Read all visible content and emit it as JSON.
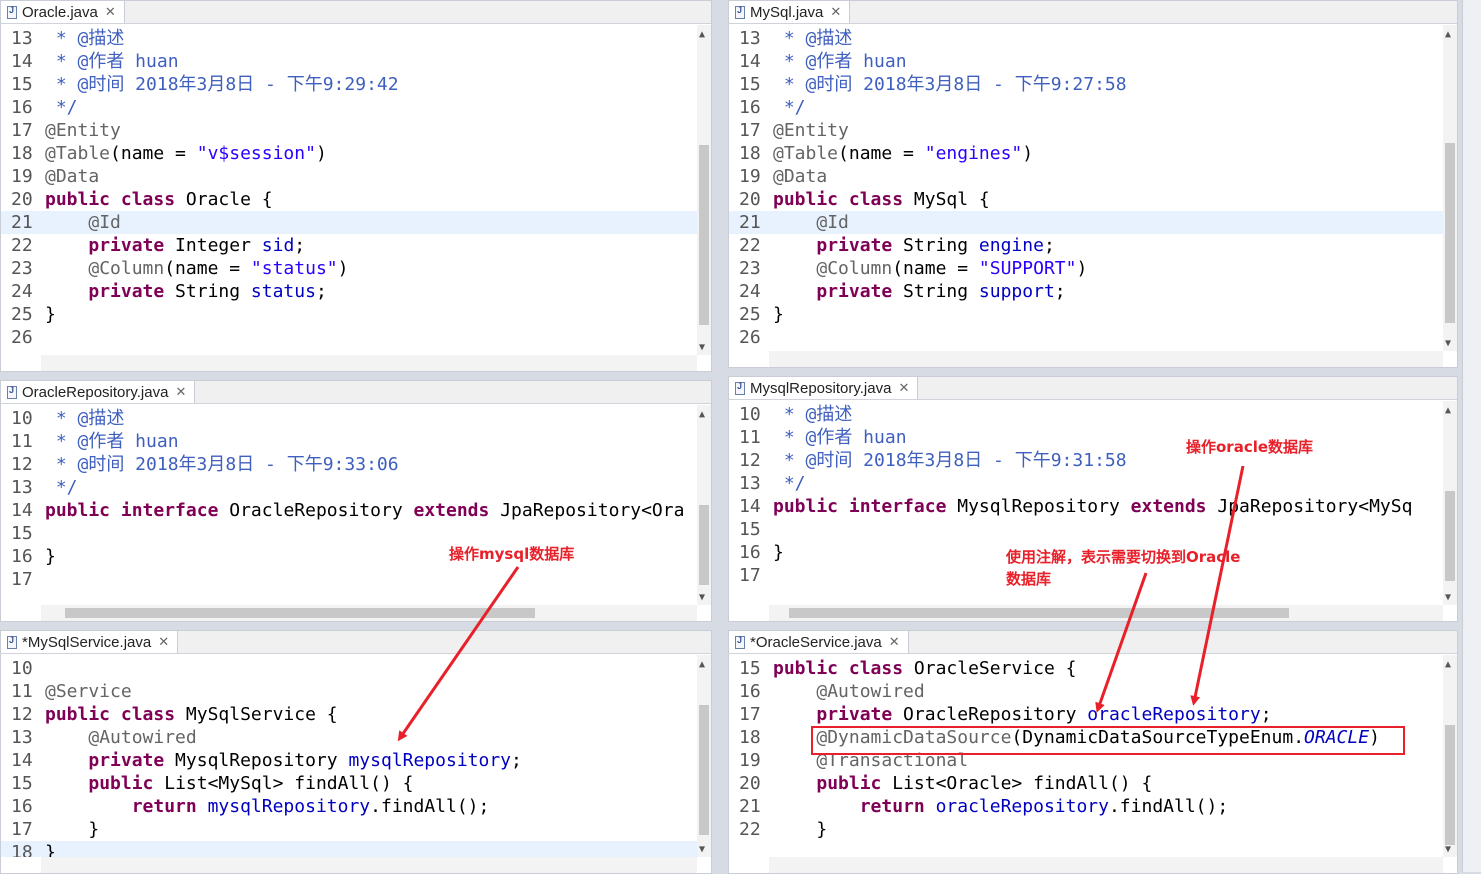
{
  "panes": {
    "oracle": {
      "tab": "Oracle.java",
      "lines": [
        {
          "n": "13",
          "t": " * @描述"
        },
        {
          "n": "14",
          "t": " * @作者 huan"
        },
        {
          "n": "15",
          "t": " * @时间 2018年3月8日 - 下午9:29:42"
        },
        {
          "n": "16",
          "t": " */"
        },
        {
          "n": "17",
          "t": "@Entity"
        },
        {
          "n": "18",
          "t": "@Table(name = \"v$session\")"
        },
        {
          "n": "19",
          "t": "@Data"
        },
        {
          "n": "20",
          "t": "public class Oracle {"
        },
        {
          "n": "21",
          "t": "    @Id"
        },
        {
          "n": "22",
          "t": "    private Integer sid;"
        },
        {
          "n": "23",
          "t": "    @Column(name = \"status\")"
        },
        {
          "n": "24",
          "t": "    private String status;"
        },
        {
          "n": "25",
          "t": "}"
        },
        {
          "n": "26",
          "t": ""
        }
      ]
    },
    "mysql": {
      "tab": "MySql.java",
      "lines": [
        {
          "n": "13",
          "t": " * @描述"
        },
        {
          "n": "14",
          "t": " * @作者 huan"
        },
        {
          "n": "15",
          "t": " * @时间 2018年3月8日 - 下午9:27:58"
        },
        {
          "n": "16",
          "t": " */"
        },
        {
          "n": "17",
          "t": "@Entity"
        },
        {
          "n": "18",
          "t": "@Table(name = \"engines\")"
        },
        {
          "n": "19",
          "t": "@Data"
        },
        {
          "n": "20",
          "t": "public class MySql {"
        },
        {
          "n": "21",
          "t": "    @Id"
        },
        {
          "n": "22",
          "t": "    private String engine;"
        },
        {
          "n": "23",
          "t": "    @Column(name = \"SUPPORT\")"
        },
        {
          "n": "24",
          "t": "    private String support;"
        },
        {
          "n": "25",
          "t": "}"
        },
        {
          "n": "26",
          "t": ""
        }
      ]
    },
    "oracleRepo": {
      "tab": "OracleRepository.java",
      "lines": [
        {
          "n": "10",
          "t": " * @描述"
        },
        {
          "n": "11",
          "t": " * @作者 huan"
        },
        {
          "n": "12",
          "t": " * @时间 2018年3月8日 - 下午9:33:06"
        },
        {
          "n": "13",
          "t": " */"
        },
        {
          "n": "14",
          "t": "public interface OracleRepository extends JpaRepository<Ora"
        },
        {
          "n": "15",
          "t": ""
        },
        {
          "n": "16",
          "t": "}"
        },
        {
          "n": "17",
          "t": ""
        }
      ]
    },
    "mysqlRepo": {
      "tab": "MysqlRepository.java",
      "lines": [
        {
          "n": "10",
          "t": " * @描述"
        },
        {
          "n": "11",
          "t": " * @作者 huan"
        },
        {
          "n": "12",
          "t": " * @时间 2018年3月8日 - 下午9:31:58"
        },
        {
          "n": "13",
          "t": " */"
        },
        {
          "n": "14",
          "t": "public interface MysqlRepository extends JpaRepository<MySq"
        },
        {
          "n": "15",
          "t": ""
        },
        {
          "n": "16",
          "t": "}"
        },
        {
          "n": "17",
          "t": ""
        }
      ]
    },
    "mysqlService": {
      "tab": "*MySqlService.java",
      "lines": [
        {
          "n": "10",
          "t": ""
        },
        {
          "n": "11",
          "t": "@Service"
        },
        {
          "n": "12",
          "t": "public class MySqlService {"
        },
        {
          "n": "13",
          "t": "    @Autowired"
        },
        {
          "n": "14",
          "t": "    private MysqlRepository mysqlRepository;"
        },
        {
          "n": "15",
          "t": "    public List<MySql> findAll() {"
        },
        {
          "n": "16",
          "t": "        return mysqlRepository.findAll();"
        },
        {
          "n": "17",
          "t": "    }"
        },
        {
          "n": "18",
          "t": "}"
        }
      ]
    },
    "oracleService": {
      "tab": "*OracleService.java",
      "lines": [
        {
          "n": "15",
          "t": "public class OracleService {"
        },
        {
          "n": "16",
          "t": "    @Autowired"
        },
        {
          "n": "17",
          "t": "    private OracleRepository oracleRepository;"
        },
        {
          "n": "18",
          "t": "    @DynamicDataSource(DynamicDataSourceTypeEnum.ORACLE)"
        },
        {
          "n": "19",
          "t": "    @Transactional"
        },
        {
          "n": "20",
          "t": "    public List<Oracle> findAll() {"
        },
        {
          "n": "21",
          "t": "        return oracleRepository.findAll();"
        },
        {
          "n": "22",
          "t": "    }"
        }
      ]
    }
  },
  "annotations": {
    "op_mysql": "操作mysql数据库",
    "op_oracle": "操作oracle数据库",
    "use_annotation_l1": "使用注解，表示需要切换到Oracle",
    "use_annotation_l2": "数据库"
  },
  "colors": {
    "annotation_red": "#e8202a",
    "keyword": "#7f0055",
    "string": "#2a00ff",
    "field": "#0000c0"
  }
}
